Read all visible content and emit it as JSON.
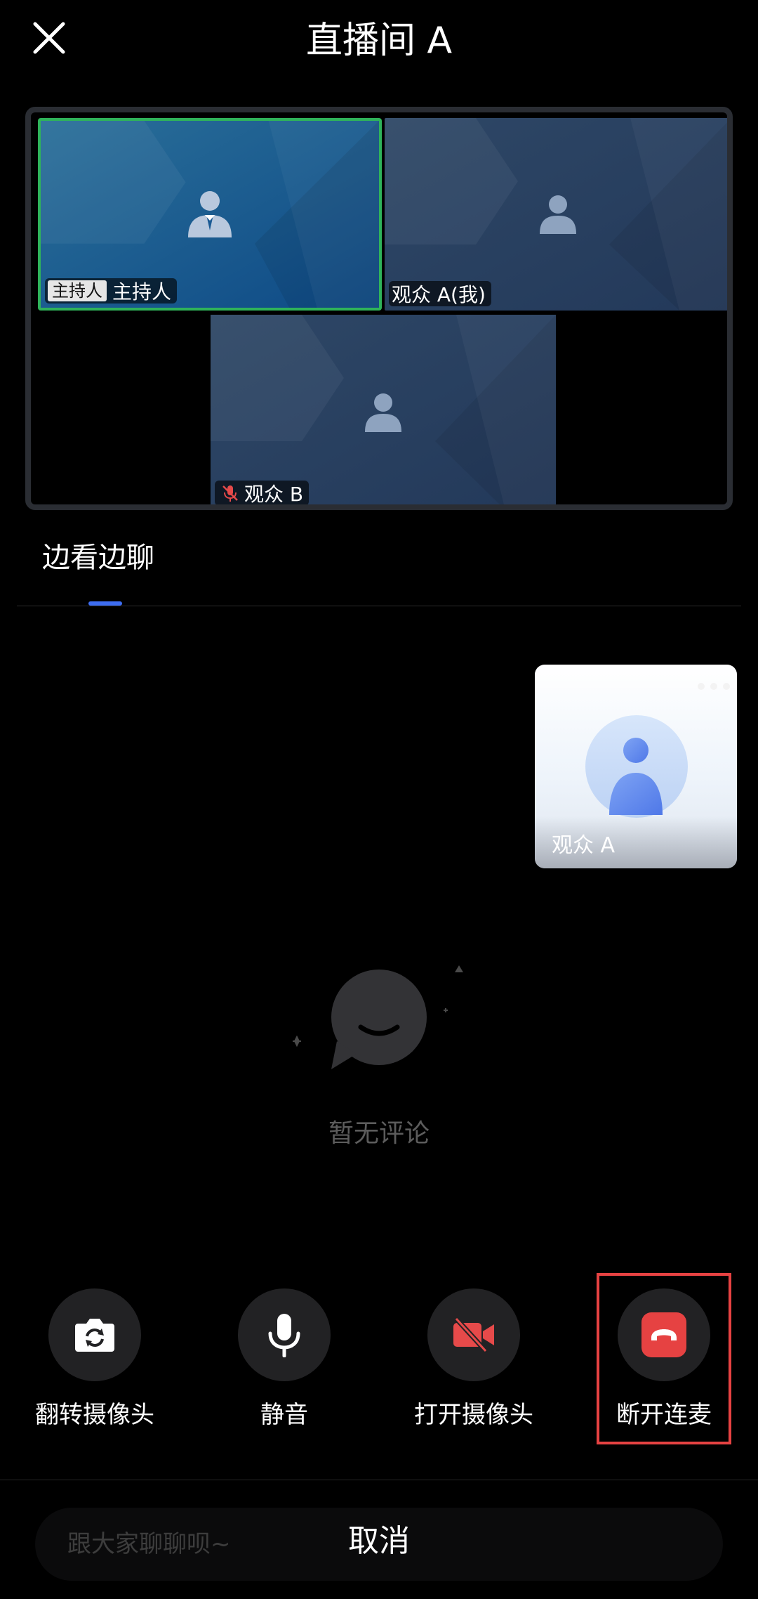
{
  "header": {
    "title": "直播间 A",
    "close_icon": "close-icon"
  },
  "video_grid": {
    "tiles": [
      {
        "name": "主持人",
        "badge": "主持人",
        "role": "host",
        "active_speaker": true,
        "icon": "host-person-icon",
        "highlight_color": "#2fb35a"
      },
      {
        "name": "观众 A(我)",
        "role": "audience",
        "icon": "person-icon"
      },
      {
        "name": "观众 B",
        "role": "audience",
        "muted": true,
        "icon": "person-icon",
        "status_icon": "mic-off-icon"
      }
    ]
  },
  "tabs": [
    {
      "label": "边看边聊",
      "active": true,
      "indicator_color": "#3d6df2"
    }
  ],
  "self_preview": {
    "name": "观众 A",
    "icon": "avatar-icon",
    "menu_icon": "more-dots-icon"
  },
  "empty_state": {
    "text": "暂无评论",
    "icon": "chat-bubble-icon"
  },
  "controls": [
    {
      "label": "翻转摄像头",
      "icon": "camera-flip-icon"
    },
    {
      "label": "静音",
      "icon": "microphone-icon"
    },
    {
      "label": "打开摄像头",
      "icon": "camera-off-icon",
      "icon_color": "#e64a4a"
    },
    {
      "label": "断开连麦",
      "icon": "hang-up-icon",
      "icon_color": "#e64242",
      "highlighted": true
    }
  ],
  "chat": {
    "placeholder": "跟大家聊聊呗~",
    "cancel_label": "取消"
  },
  "colors": {
    "background": "#000000",
    "accent": "#3d6df2",
    "danger": "#e64242",
    "speaker_border": "#2fb35a"
  }
}
